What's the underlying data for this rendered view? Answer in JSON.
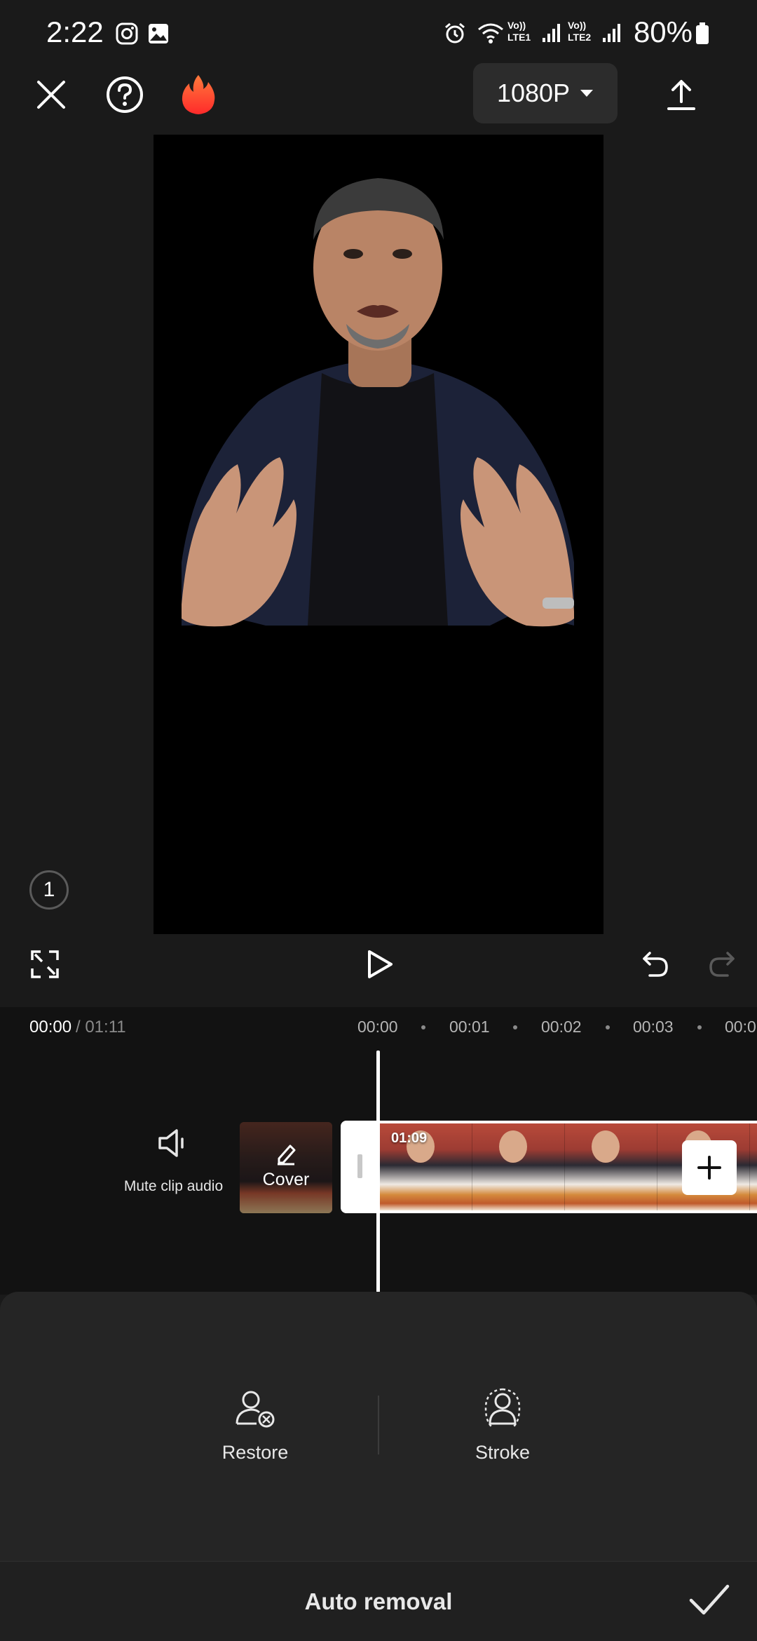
{
  "status_bar": {
    "time": "2:22",
    "battery": "80%",
    "lte1": "Vo)) LTE1",
    "lte2": "Vo)) LTE2"
  },
  "top_bar": {
    "resolution": "1080P",
    "icons": [
      "close-icon",
      "help-icon",
      "flame-icon",
      "export-icon"
    ]
  },
  "preview": {
    "clip_count": "1"
  },
  "timeline": {
    "current_time": "00:00",
    "total_time": "/ 01:11",
    "ruler": [
      "00:00",
      "00:01",
      "00:02",
      "00:03",
      "00:0"
    ],
    "mute_label": "Mute clip audio",
    "cover_label": "Cover",
    "clip_duration": "01:09"
  },
  "tools": {
    "restore": "Restore",
    "stroke": "Stroke"
  },
  "footer": {
    "title": "Auto removal"
  },
  "colors": {
    "background": "#1a1a1a",
    "panel": "#252525",
    "accent_flame": "#ff4a2a"
  }
}
